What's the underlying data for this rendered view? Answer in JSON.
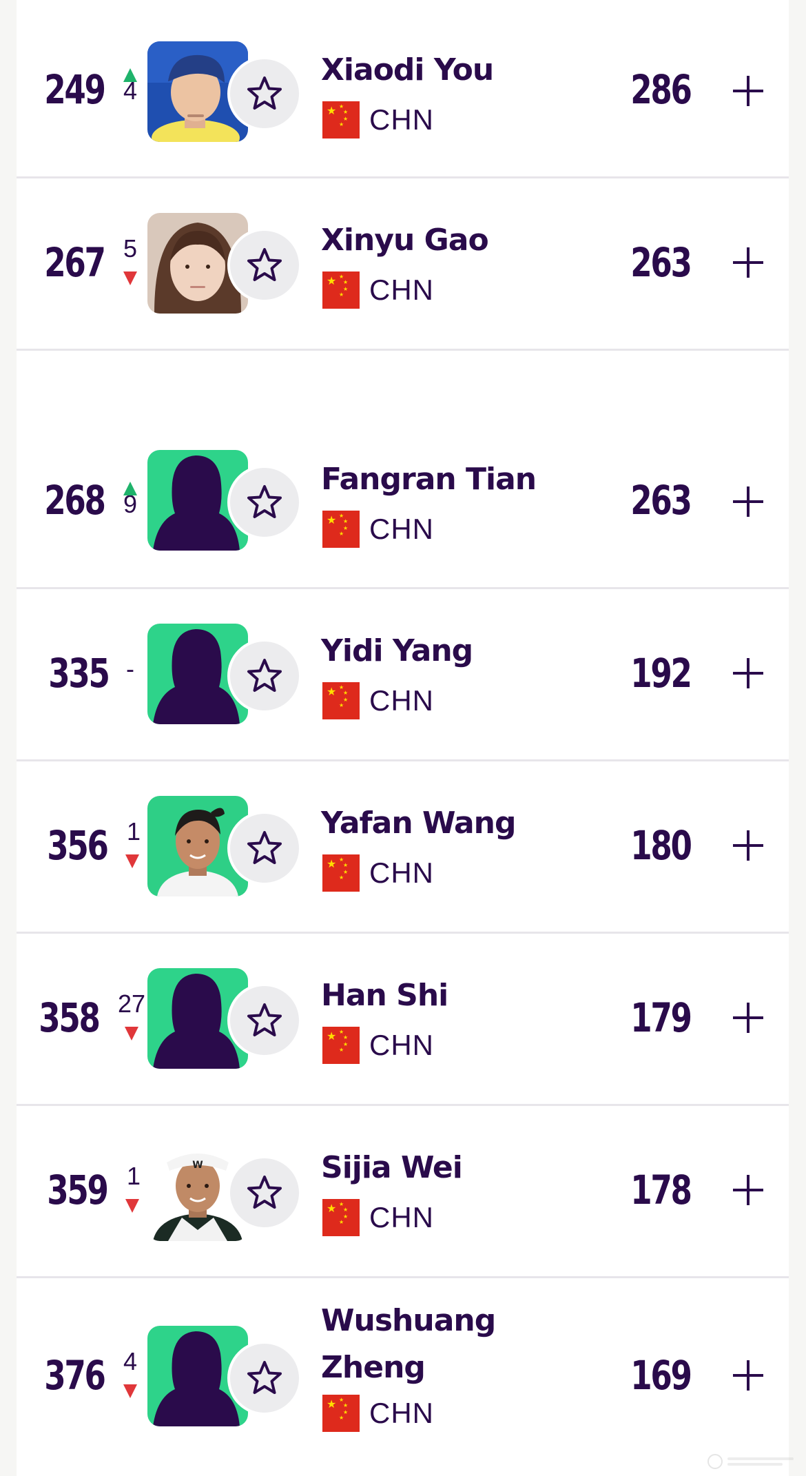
{
  "colors": {
    "text": "#2a0b4b",
    "up": "#1fb36b",
    "down": "#e0373a",
    "silhouette_bg": "#2ed38a",
    "flag": "#de2a1c"
  },
  "players": [
    {
      "rank": "249",
      "move": "4",
      "dir": "up",
      "name": "Xiaodi You",
      "country": "CHN",
      "points": "286",
      "avatar": "photo-blue-cap"
    },
    {
      "rank": "267",
      "move": "5",
      "dir": "down",
      "name": "Xinyu Gao",
      "country": "CHN",
      "points": "263",
      "avatar": "photo-portrait"
    },
    {
      "rank": "268",
      "move": "9",
      "dir": "up",
      "name": "Fangran Tian",
      "country": "CHN",
      "points": "263",
      "avatar": "silhouette"
    },
    {
      "rank": "335",
      "move": "-",
      "dir": "none",
      "name": "Yidi Yang",
      "country": "CHN",
      "points": "192",
      "avatar": "silhouette"
    },
    {
      "rank": "356",
      "move": "1",
      "dir": "down",
      "name": "Yafan Wang",
      "country": "CHN",
      "points": "180",
      "avatar": "photo-green-bg"
    },
    {
      "rank": "358",
      "move": "27",
      "dir": "down",
      "name": "Han Shi",
      "country": "CHN",
      "points": "179",
      "avatar": "silhouette"
    },
    {
      "rank": "359",
      "move": "1",
      "dir": "down",
      "name": "Sijia Wei",
      "country": "CHN",
      "points": "178",
      "avatar": "photo-white-visor"
    },
    {
      "rank": "376",
      "move": "4",
      "dir": "down",
      "name": "Wushuang Zheng",
      "country": "CHN",
      "points": "169",
      "avatar": "silhouette"
    }
  ],
  "icons": {
    "favorite": "star-icon",
    "expand": "plus-icon",
    "flag": "china-flag-icon"
  }
}
